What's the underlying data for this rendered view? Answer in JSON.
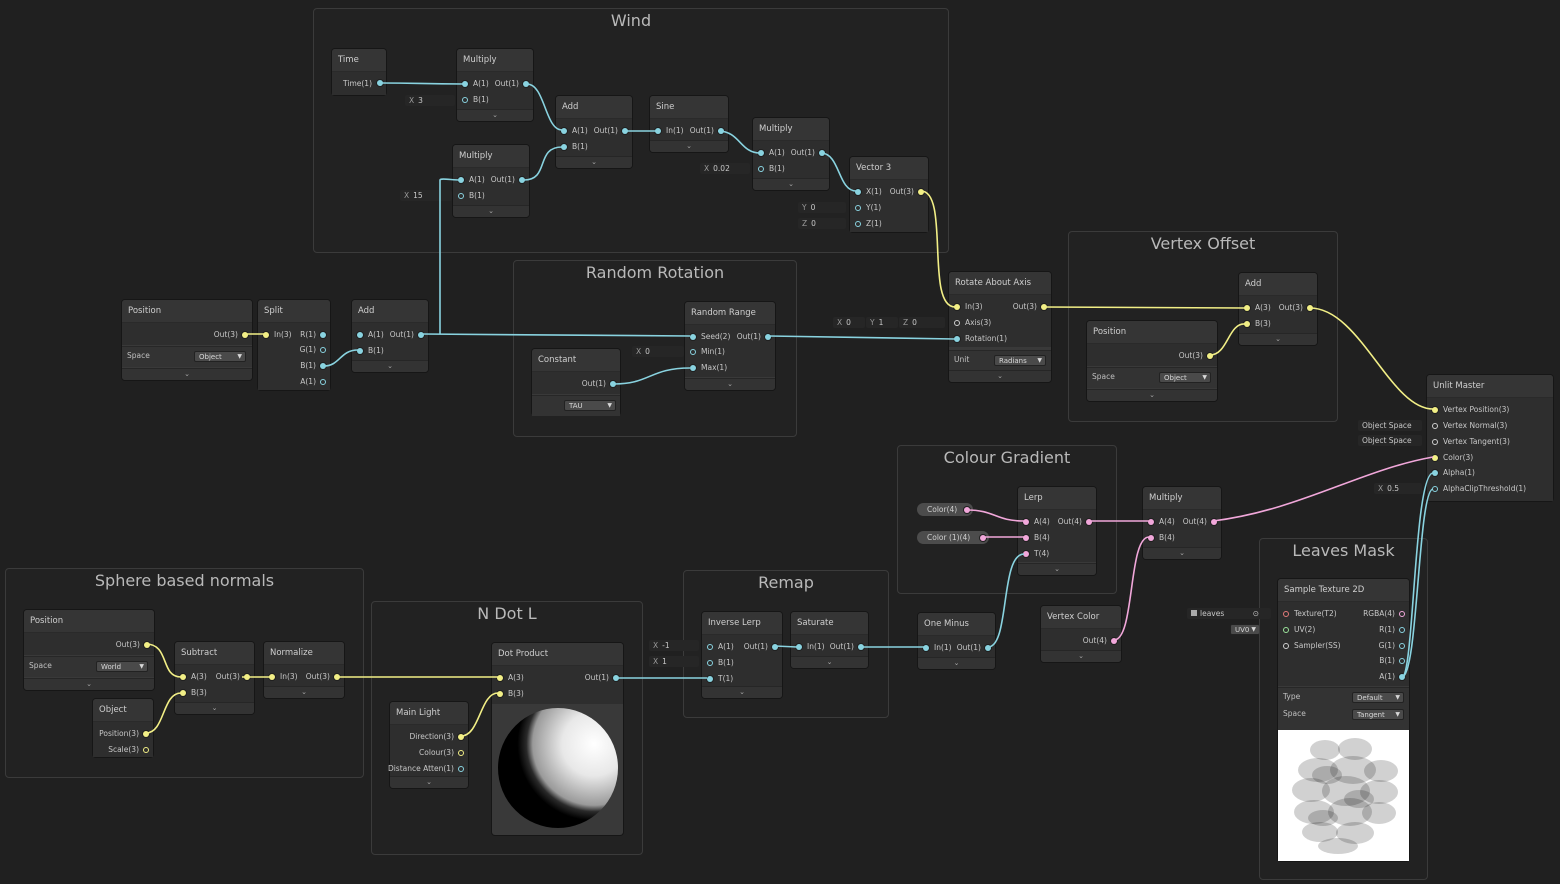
{
  "groups": {
    "wind": "Wind",
    "random_rotation": "Random Rotation",
    "vertex_offset": "Vertex Offset",
    "colour_gradient": "Colour Gradient",
    "sphere_normals": "Sphere based normals",
    "n_dot_l": "N Dot L",
    "remap": "Remap",
    "leaves_mask": "Leaves Mask"
  },
  "nodes": {
    "time": {
      "title": "Time",
      "out": "Time(1)"
    },
    "wind_mul1": {
      "title": "Multiply",
      "a": "A(1)",
      "b": "B(1)",
      "out": "Out(1)",
      "b_field_label": "X",
      "b_field_value": "3"
    },
    "wind_mul2": {
      "title": "Multiply",
      "a": "A(1)",
      "b": "B(1)",
      "out": "Out(1)",
      "b_field_label": "X",
      "b_field_value": "15"
    },
    "wind_add": {
      "title": "Add",
      "a": "A(1)",
      "b": "B(1)",
      "out": "Out(1)"
    },
    "sine": {
      "title": "Sine",
      "in": "In(1)",
      "out": "Out(1)"
    },
    "wind_mul3": {
      "title": "Multiply",
      "a": "A(1)",
      "b": "B(1)",
      "out": "Out(1)",
      "b_field_label": "X",
      "b_field_value": "0.02"
    },
    "vector3": {
      "title": "Vector 3",
      "x": "X(1)",
      "y": "Y(1)",
      "z": "Z(1)",
      "out": "Out(3)",
      "y_label": "Y",
      "y_value": "0",
      "z_label": "Z",
      "z_value": "0"
    },
    "position1": {
      "title": "Position",
      "out": "Out(3)",
      "space_label": "Space",
      "space_value": "Object"
    },
    "split": {
      "title": "Split",
      "in": "In(3)",
      "r": "R(1)",
      "g": "G(1)",
      "b": "B(1)",
      "a": "A(1)"
    },
    "add_main": {
      "title": "Add",
      "a": "A(1)",
      "b": "B(1)",
      "out": "Out(1)"
    },
    "constant": {
      "title": "Constant",
      "out": "Out(1)",
      "value": "TAU"
    },
    "random_range": {
      "title": "Random Range",
      "seed": "Seed(2)",
      "min": "Min(1)",
      "max": "Max(1)",
      "out": "Out(1)",
      "min_label": "X",
      "min_value": "0"
    },
    "rotate": {
      "title": "Rotate About Axis",
      "in": "In(3)",
      "axis": "Axis(3)",
      "rotation": "Rotation(1)",
      "out": "Out(3)",
      "unit_label": "Unit",
      "unit_value": "Radians",
      "axis_x_label": "X",
      "axis_x": "0",
      "axis_y_label": "Y",
      "axis_y": "1",
      "axis_z_label": "Z",
      "axis_z": "0"
    },
    "position2": {
      "title": "Position",
      "out": "Out(3)",
      "space_label": "Space",
      "space_value": "Object"
    },
    "vo_add": {
      "title": "Add",
      "a": "A(3)",
      "b": "B(3)",
      "out": "Out(3)"
    },
    "master": {
      "title": "Unlit Master",
      "p1": "Vertex Position(3)",
      "p2": "Vertex Normal(3)",
      "p3": "Vertex Tangent(3)",
      "p4": "Color(3)",
      "p5": "Alpha(1)",
      "p6": "AlphaClipThreshold(1)",
      "normal_field": "Object Space",
      "tangent_field": "Object Space",
      "alpha_clip_label": "X",
      "alpha_clip_value": "0.5"
    },
    "lerp": {
      "title": "Lerp",
      "a": "A(4)",
      "b": "B(4)",
      "t": "T(4)",
      "out": "Out(4)"
    },
    "color_a": "Color(4)",
    "color_b": "Color (1)(4)",
    "cg_mul": {
      "title": "Multiply",
      "a": "A(4)",
      "b": "B(4)",
      "out": "Out(4)"
    },
    "vertex_color": {
      "title": "Vertex Color",
      "out": "Out(4)"
    },
    "position3": {
      "title": "Position",
      "out": "Out(3)",
      "space_label": "Space",
      "space_value": "World"
    },
    "object": {
      "title": "Object",
      "position": "Position(3)",
      "scale": "Scale(3)"
    },
    "subtract": {
      "title": "Subtract",
      "a": "A(3)",
      "b": "B(3)",
      "out": "Out(3)"
    },
    "normalize": {
      "title": "Normalize",
      "in": "In(3)",
      "out": "Out(3)"
    },
    "main_light": {
      "title": "Main Light",
      "direction": "Direction(3)",
      "colour": "Colour(3)",
      "distance": "Distance Atten(1)"
    },
    "dot_product": {
      "title": "Dot Product",
      "a": "A(3)",
      "b": "B(3)",
      "out": "Out(1)"
    },
    "inverse_lerp": {
      "title": "Inverse Lerp",
      "a": "A(1)",
      "b": "B(1)",
      "t": "T(1)",
      "out": "Out(1)",
      "a_label": "X",
      "a_value": "-1",
      "b_label": "X",
      "b_value": "1"
    },
    "saturate": {
      "title": "Saturate",
      "in": "In(1)",
      "out": "Out(1)"
    },
    "one_minus": {
      "title": "One Minus",
      "in": "In(1)",
      "out": "Out(1)"
    },
    "sample_tex": {
      "title": "Sample Texture 2D",
      "texture": "Texture(T2)",
      "uv": "UV(2)",
      "sampler": "Sampler(SS)",
      "rgba": "RGBA(4)",
      "r": "R(1)",
      "g": "G(1)",
      "b": "B(1)",
      "a": "A(1)",
      "type_label": "Type",
      "type_value": "Default",
      "space_label": "Space",
      "space_value": "Tangent",
      "tex_field": "leaves",
      "uv_field": "UV0"
    }
  },
  "colors": {
    "background": "#202020",
    "node": "#393939",
    "wire_vector1": "#89d3e0",
    "wire_vector3": "#f2ef86",
    "wire_vector4": "#f1a7da"
  }
}
